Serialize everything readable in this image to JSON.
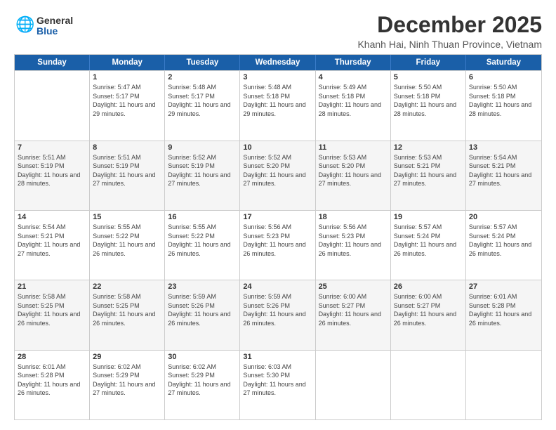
{
  "logo": {
    "general": "General",
    "blue": "Blue"
  },
  "title": "December 2025",
  "subtitle": "Khanh Hai, Ninh Thuan Province, Vietnam",
  "headers": [
    "Sunday",
    "Monday",
    "Tuesday",
    "Wednesday",
    "Thursday",
    "Friday",
    "Saturday"
  ],
  "weeks": [
    [
      {
        "day": "",
        "sunrise": "",
        "sunset": "",
        "daylight": ""
      },
      {
        "day": "1",
        "sunrise": "Sunrise: 5:47 AM",
        "sunset": "Sunset: 5:17 PM",
        "daylight": "Daylight: 11 hours and 29 minutes."
      },
      {
        "day": "2",
        "sunrise": "Sunrise: 5:48 AM",
        "sunset": "Sunset: 5:17 PM",
        "daylight": "Daylight: 11 hours and 29 minutes."
      },
      {
        "day": "3",
        "sunrise": "Sunrise: 5:48 AM",
        "sunset": "Sunset: 5:18 PM",
        "daylight": "Daylight: 11 hours and 29 minutes."
      },
      {
        "day": "4",
        "sunrise": "Sunrise: 5:49 AM",
        "sunset": "Sunset: 5:18 PM",
        "daylight": "Daylight: 11 hours and 28 minutes."
      },
      {
        "day": "5",
        "sunrise": "Sunrise: 5:50 AM",
        "sunset": "Sunset: 5:18 PM",
        "daylight": "Daylight: 11 hours and 28 minutes."
      },
      {
        "day": "6",
        "sunrise": "Sunrise: 5:50 AM",
        "sunset": "Sunset: 5:18 PM",
        "daylight": "Daylight: 11 hours and 28 minutes."
      }
    ],
    [
      {
        "day": "7",
        "sunrise": "Sunrise: 5:51 AM",
        "sunset": "Sunset: 5:19 PM",
        "daylight": "Daylight: 11 hours and 28 minutes."
      },
      {
        "day": "8",
        "sunrise": "Sunrise: 5:51 AM",
        "sunset": "Sunset: 5:19 PM",
        "daylight": "Daylight: 11 hours and 27 minutes."
      },
      {
        "day": "9",
        "sunrise": "Sunrise: 5:52 AM",
        "sunset": "Sunset: 5:19 PM",
        "daylight": "Daylight: 11 hours and 27 minutes."
      },
      {
        "day": "10",
        "sunrise": "Sunrise: 5:52 AM",
        "sunset": "Sunset: 5:20 PM",
        "daylight": "Daylight: 11 hours and 27 minutes."
      },
      {
        "day": "11",
        "sunrise": "Sunrise: 5:53 AM",
        "sunset": "Sunset: 5:20 PM",
        "daylight": "Daylight: 11 hours and 27 minutes."
      },
      {
        "day": "12",
        "sunrise": "Sunrise: 5:53 AM",
        "sunset": "Sunset: 5:21 PM",
        "daylight": "Daylight: 11 hours and 27 minutes."
      },
      {
        "day": "13",
        "sunrise": "Sunrise: 5:54 AM",
        "sunset": "Sunset: 5:21 PM",
        "daylight": "Daylight: 11 hours and 27 minutes."
      }
    ],
    [
      {
        "day": "14",
        "sunrise": "Sunrise: 5:54 AM",
        "sunset": "Sunset: 5:21 PM",
        "daylight": "Daylight: 11 hours and 27 minutes."
      },
      {
        "day": "15",
        "sunrise": "Sunrise: 5:55 AM",
        "sunset": "Sunset: 5:22 PM",
        "daylight": "Daylight: 11 hours and 26 minutes."
      },
      {
        "day": "16",
        "sunrise": "Sunrise: 5:55 AM",
        "sunset": "Sunset: 5:22 PM",
        "daylight": "Daylight: 11 hours and 26 minutes."
      },
      {
        "day": "17",
        "sunrise": "Sunrise: 5:56 AM",
        "sunset": "Sunset: 5:23 PM",
        "daylight": "Daylight: 11 hours and 26 minutes."
      },
      {
        "day": "18",
        "sunrise": "Sunrise: 5:56 AM",
        "sunset": "Sunset: 5:23 PM",
        "daylight": "Daylight: 11 hours and 26 minutes."
      },
      {
        "day": "19",
        "sunrise": "Sunrise: 5:57 AM",
        "sunset": "Sunset: 5:24 PM",
        "daylight": "Daylight: 11 hours and 26 minutes."
      },
      {
        "day": "20",
        "sunrise": "Sunrise: 5:57 AM",
        "sunset": "Sunset: 5:24 PM",
        "daylight": "Daylight: 11 hours and 26 minutes."
      }
    ],
    [
      {
        "day": "21",
        "sunrise": "Sunrise: 5:58 AM",
        "sunset": "Sunset: 5:25 PM",
        "daylight": "Daylight: 11 hours and 26 minutes."
      },
      {
        "day": "22",
        "sunrise": "Sunrise: 5:58 AM",
        "sunset": "Sunset: 5:25 PM",
        "daylight": "Daylight: 11 hours and 26 minutes."
      },
      {
        "day": "23",
        "sunrise": "Sunrise: 5:59 AM",
        "sunset": "Sunset: 5:26 PM",
        "daylight": "Daylight: 11 hours and 26 minutes."
      },
      {
        "day": "24",
        "sunrise": "Sunrise: 5:59 AM",
        "sunset": "Sunset: 5:26 PM",
        "daylight": "Daylight: 11 hours and 26 minutes."
      },
      {
        "day": "25",
        "sunrise": "Sunrise: 6:00 AM",
        "sunset": "Sunset: 5:27 PM",
        "daylight": "Daylight: 11 hours and 26 minutes."
      },
      {
        "day": "26",
        "sunrise": "Sunrise: 6:00 AM",
        "sunset": "Sunset: 5:27 PM",
        "daylight": "Daylight: 11 hours and 26 minutes."
      },
      {
        "day": "27",
        "sunrise": "Sunrise: 6:01 AM",
        "sunset": "Sunset: 5:28 PM",
        "daylight": "Daylight: 11 hours and 26 minutes."
      }
    ],
    [
      {
        "day": "28",
        "sunrise": "Sunrise: 6:01 AM",
        "sunset": "Sunset: 5:28 PM",
        "daylight": "Daylight: 11 hours and 26 minutes."
      },
      {
        "day": "29",
        "sunrise": "Sunrise: 6:02 AM",
        "sunset": "Sunset: 5:29 PM",
        "daylight": "Daylight: 11 hours and 27 minutes."
      },
      {
        "day": "30",
        "sunrise": "Sunrise: 6:02 AM",
        "sunset": "Sunset: 5:29 PM",
        "daylight": "Daylight: 11 hours and 27 minutes."
      },
      {
        "day": "31",
        "sunrise": "Sunrise: 6:03 AM",
        "sunset": "Sunset: 5:30 PM",
        "daylight": "Daylight: 11 hours and 27 minutes."
      },
      {
        "day": "",
        "sunrise": "",
        "sunset": "",
        "daylight": ""
      },
      {
        "day": "",
        "sunrise": "",
        "sunset": "",
        "daylight": ""
      },
      {
        "day": "",
        "sunrise": "",
        "sunset": "",
        "daylight": ""
      }
    ]
  ]
}
